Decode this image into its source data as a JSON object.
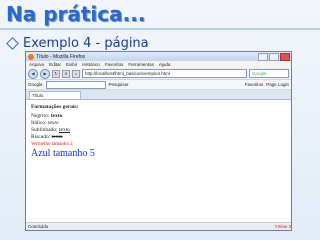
{
  "slide": {
    "title": "Na prática...",
    "bullet": "Exemplo 4 - página"
  },
  "browser": {
    "window_title": "Título - Mozilla Firefox",
    "menu": [
      "Arquivo",
      "Editar",
      "Exibir",
      "Histórico",
      "Favoritos",
      "Ferramentas",
      "Ajuda"
    ],
    "url": "http://localhost/html_basico/exemplo4.html",
    "search_placeholder": "Google",
    "google_label": "Google",
    "pesquisar_label": "Pesquisar",
    "favoritos_label": "Favoritos",
    "pagerank_label": "Page Login",
    "tab_title": "Título",
    "status": "Concluído",
    "addon": "YSlow 3"
  },
  "page": {
    "heading": "Formatações gerais:",
    "lines": [
      {
        "label": "Negrito: ",
        "value": "texto",
        "style": "bold"
      },
      {
        "label": "Itálico: ",
        "value": "texto",
        "style": "italic"
      },
      {
        "label": "Sublinhado: ",
        "value": "texto",
        "style": "underline"
      },
      {
        "label": "Riscado: ",
        "value": "texto",
        "style": "strike"
      }
    ],
    "red_text": "Vermelho tamanho 2",
    "blue_text": "Azul tamanho 5"
  },
  "colors": {
    "title_blue": "#2a6ad0",
    "red_text": "#e02020",
    "blue_text": "#1a2fd0"
  }
}
